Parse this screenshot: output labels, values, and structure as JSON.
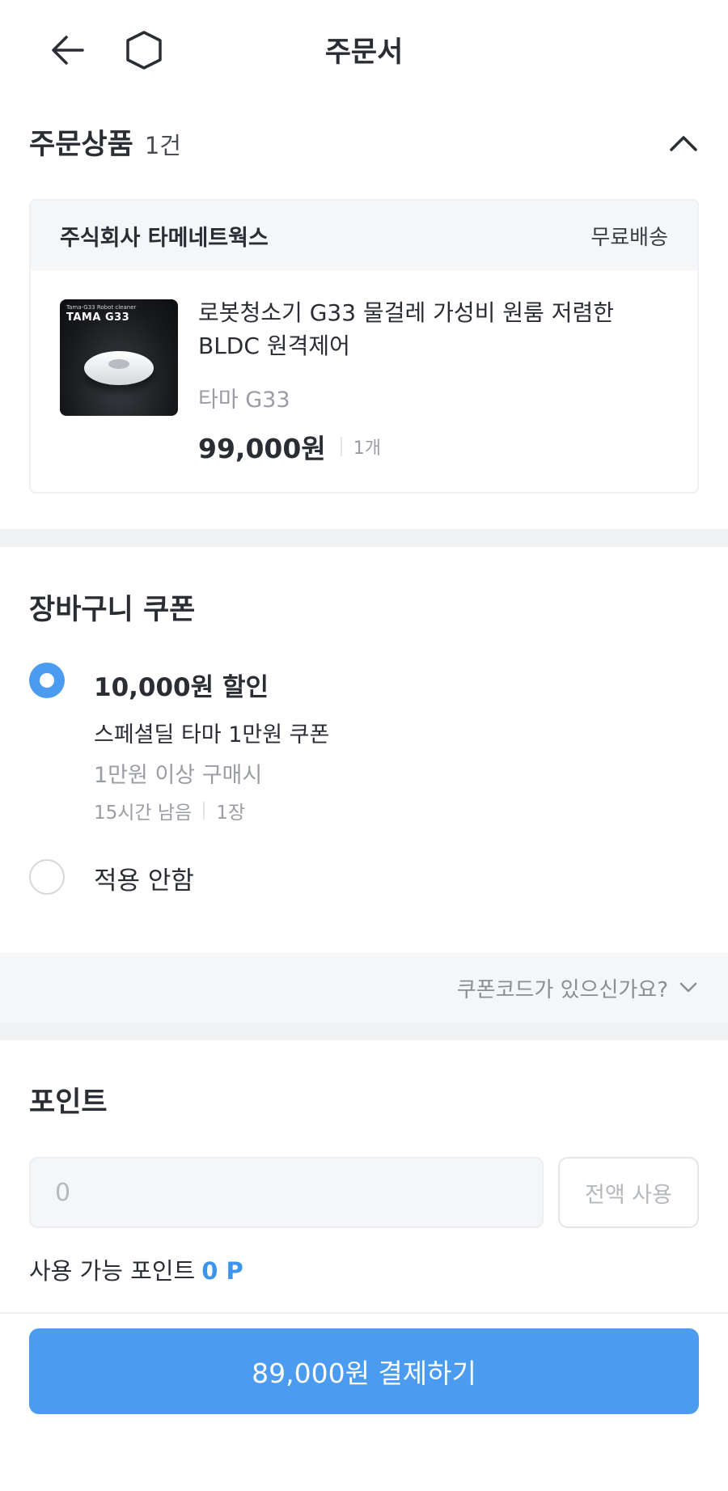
{
  "header": {
    "title": "주문서",
    "back_icon": "arrow-left-icon",
    "home_icon": "home-icon"
  },
  "order_products": {
    "title": "주문상품",
    "count": "1건",
    "collapse_icon": "chevron-up-icon",
    "seller": {
      "name": "주식회사 타메네트웍스",
      "shipping": "무료배송"
    },
    "product": {
      "thumb_small_text": "Tama-G33 Robot cleaner",
      "thumb_brand": "TAMA G33",
      "name": "로봇청소기 G33 물걸레 가성비 원룸 저렴한 BLDC 원격제어",
      "option": "타마 G33",
      "price": "99,000원",
      "quantity": "1개"
    }
  },
  "coupon": {
    "title": "장바구니 쿠폰",
    "options": [
      {
        "selected": true,
        "amount": "10,000원 할인",
        "name": "스페셜딜 타마 1만원 쿠폰",
        "condition": "1만원 이상 구매시",
        "time_left": "15시간 남음",
        "count": "1장"
      },
      {
        "selected": false,
        "label": "적용 안함"
      }
    ],
    "code_link": "쿠폰코드가 있으신가요?",
    "code_icon": "chevron-down-icon"
  },
  "points": {
    "title": "포인트",
    "input_placeholder": "0",
    "use_all_label": "전액 사용",
    "available_label": "사용 가능 포인트",
    "available_value": "0 P"
  },
  "pay_button": "89,000원 결제하기",
  "colors": {
    "accent": "#4b9cf0",
    "points_value": "#3b94ee",
    "band": "#f0f1f3"
  }
}
